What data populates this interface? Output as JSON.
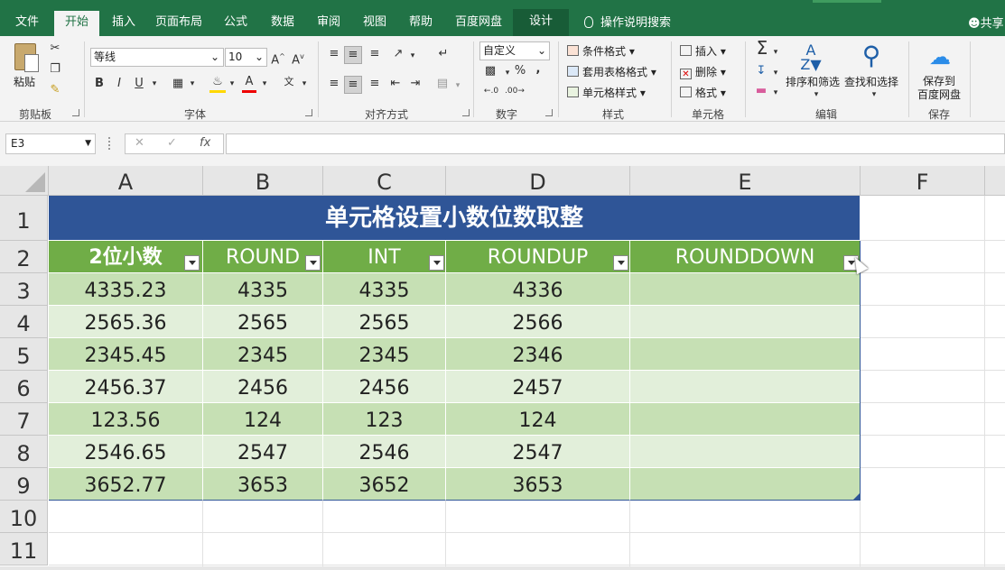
{
  "ribbon_tabs": [
    "文件",
    "开始",
    "插入",
    "页面布局",
    "公式",
    "数据",
    "审阅",
    "视图",
    "帮助",
    "百度网盘",
    "设计"
  ],
  "tell_me": "操作说明搜索",
  "share": "共享",
  "clipboard": {
    "paste": "粘贴",
    "label": "剪贴板"
  },
  "font": {
    "name": "等线",
    "size": "10",
    "label": "字体",
    "bold": "B",
    "italic": "I",
    "underline": "U"
  },
  "alignment": {
    "label": "对齐方式"
  },
  "number": {
    "format": "自定义",
    "label": "数字",
    "percent": "%",
    "comma": ","
  },
  "styles": {
    "conditional": "条件格式",
    "table_format": "套用表格格式",
    "cell_styles": "单元格样式",
    "label": "样式"
  },
  "cells": {
    "insert": "插入",
    "delete": "删除",
    "format": "格式",
    "label": "单元格"
  },
  "editing": {
    "sort_filter": "排序和筛选",
    "find_select": "查找和选择",
    "label": "编辑"
  },
  "save": {
    "line1": "保存到",
    "line2": "百度网盘",
    "label": "保存"
  },
  "formula_bar": {
    "name_box": "E3",
    "formula": ""
  },
  "columns": [
    "A",
    "B",
    "C",
    "D",
    "E",
    "F"
  ],
  "rows": [
    "1",
    "2",
    "3",
    "4",
    "5",
    "6",
    "7",
    "8",
    "9",
    "10",
    "11"
  ],
  "sheet": {
    "title": "单元格设置小数位数取整",
    "headers": [
      "2位小数",
      "ROUND",
      "INT",
      "ROUNDUP",
      "ROUNDDOWN"
    ],
    "data": [
      [
        "4335.23",
        "4335",
        "4335",
        "4336",
        ""
      ],
      [
        "2565.36",
        "2565",
        "2565",
        "2566",
        ""
      ],
      [
        "2345.45",
        "2345",
        "2345",
        "2346",
        ""
      ],
      [
        "2456.37",
        "2456",
        "2456",
        "2457",
        ""
      ],
      [
        "123.56",
        "124",
        "123",
        "124",
        ""
      ],
      [
        "2546.65",
        "2547",
        "2546",
        "2547",
        ""
      ],
      [
        "3652.77",
        "3653",
        "3652",
        "3653",
        ""
      ]
    ]
  },
  "colors": {
    "ribbon_green": "#217346",
    "title_blue": "#2f5597",
    "header_green": "#70ad47",
    "band_dark": "#c6e0b4",
    "band_light": "#e2efda"
  }
}
